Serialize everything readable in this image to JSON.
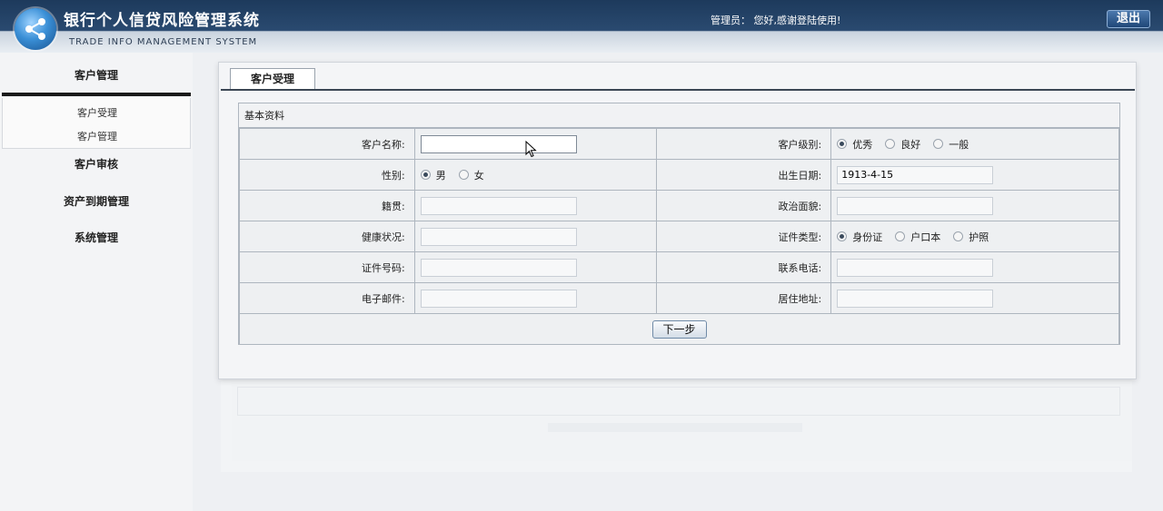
{
  "header": {
    "title": "银行个人信贷风险管理系统",
    "subtitle": "TRADE INFO MANAGEMENT SYSTEM",
    "welcome": "管理员： 您好,感谢登陆使用!",
    "logout_label": "退出"
  },
  "sidebar": {
    "menu": [
      {
        "label": "客户管理"
      },
      {
        "label": "客户审核"
      },
      {
        "label": "资产到期管理"
      },
      {
        "label": "系统管理"
      }
    ],
    "submenu": [
      {
        "label": "客户受理"
      },
      {
        "label": "客户管理"
      }
    ]
  },
  "main": {
    "tab_label": "客户受理",
    "section_title": "基本资料",
    "fields": {
      "customer_name": {
        "label": "客户名称:",
        "value": ""
      },
      "customer_level": {
        "label": "客户级别:",
        "options": [
          "优秀",
          "良好",
          "一般"
        ],
        "selected": "优秀"
      },
      "gender": {
        "label": "性别:",
        "options": [
          "男",
          "女"
        ],
        "selected": "男"
      },
      "birth_date": {
        "label": "出生日期:",
        "value": "1913-4-15"
      },
      "native_place": {
        "label": "籍贯:",
        "value": ""
      },
      "political_status": {
        "label": "政治面貌:",
        "value": ""
      },
      "health": {
        "label": "健康状况:",
        "value": ""
      },
      "id_type": {
        "label": "证件类型:",
        "options": [
          "身份证",
          "户口本",
          "护照"
        ],
        "selected": "身份证"
      },
      "id_number": {
        "label": "证件号码:",
        "value": ""
      },
      "phone": {
        "label": "联系电话:",
        "value": ""
      },
      "email": {
        "label": "电子邮件:",
        "value": ""
      },
      "address": {
        "label": "居住地址:",
        "value": ""
      }
    },
    "next_label": "下一步"
  }
}
